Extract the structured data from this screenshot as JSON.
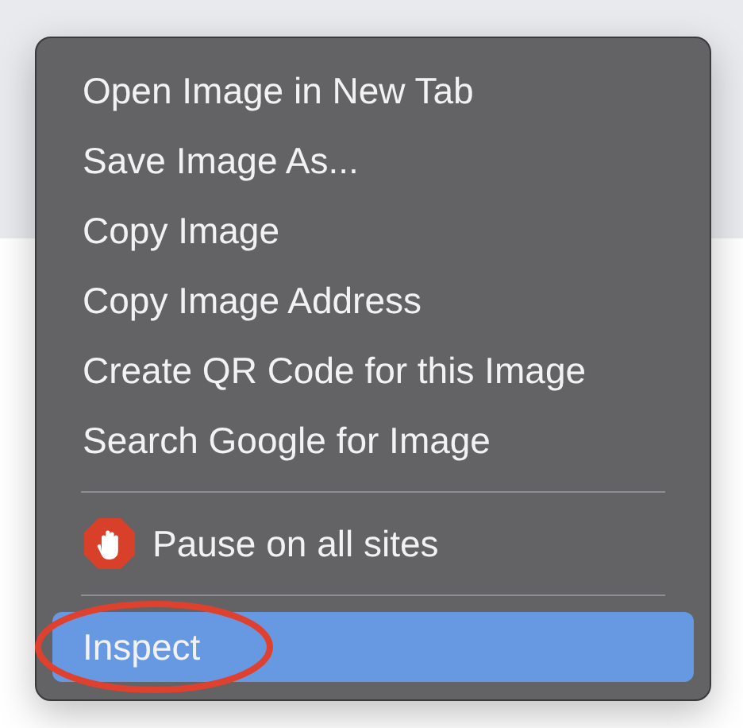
{
  "menu": {
    "items": [
      {
        "kind": "item",
        "label": "Open Image in New Tab",
        "selected": false
      },
      {
        "kind": "item",
        "label": "Save Image As...",
        "selected": false
      },
      {
        "kind": "item",
        "label": "Copy Image",
        "selected": false
      },
      {
        "kind": "item",
        "label": "Copy Image Address",
        "selected": false
      },
      {
        "kind": "item",
        "label": "Create QR Code for this Image",
        "selected": false
      },
      {
        "kind": "item",
        "label": "Search Google for Image",
        "selected": false
      },
      {
        "kind": "separator"
      },
      {
        "kind": "extension",
        "label": "Pause on all sites",
        "selected": false
      },
      {
        "kind": "separator"
      },
      {
        "kind": "item",
        "label": "Inspect",
        "selected": true,
        "circled": true
      }
    ]
  }
}
